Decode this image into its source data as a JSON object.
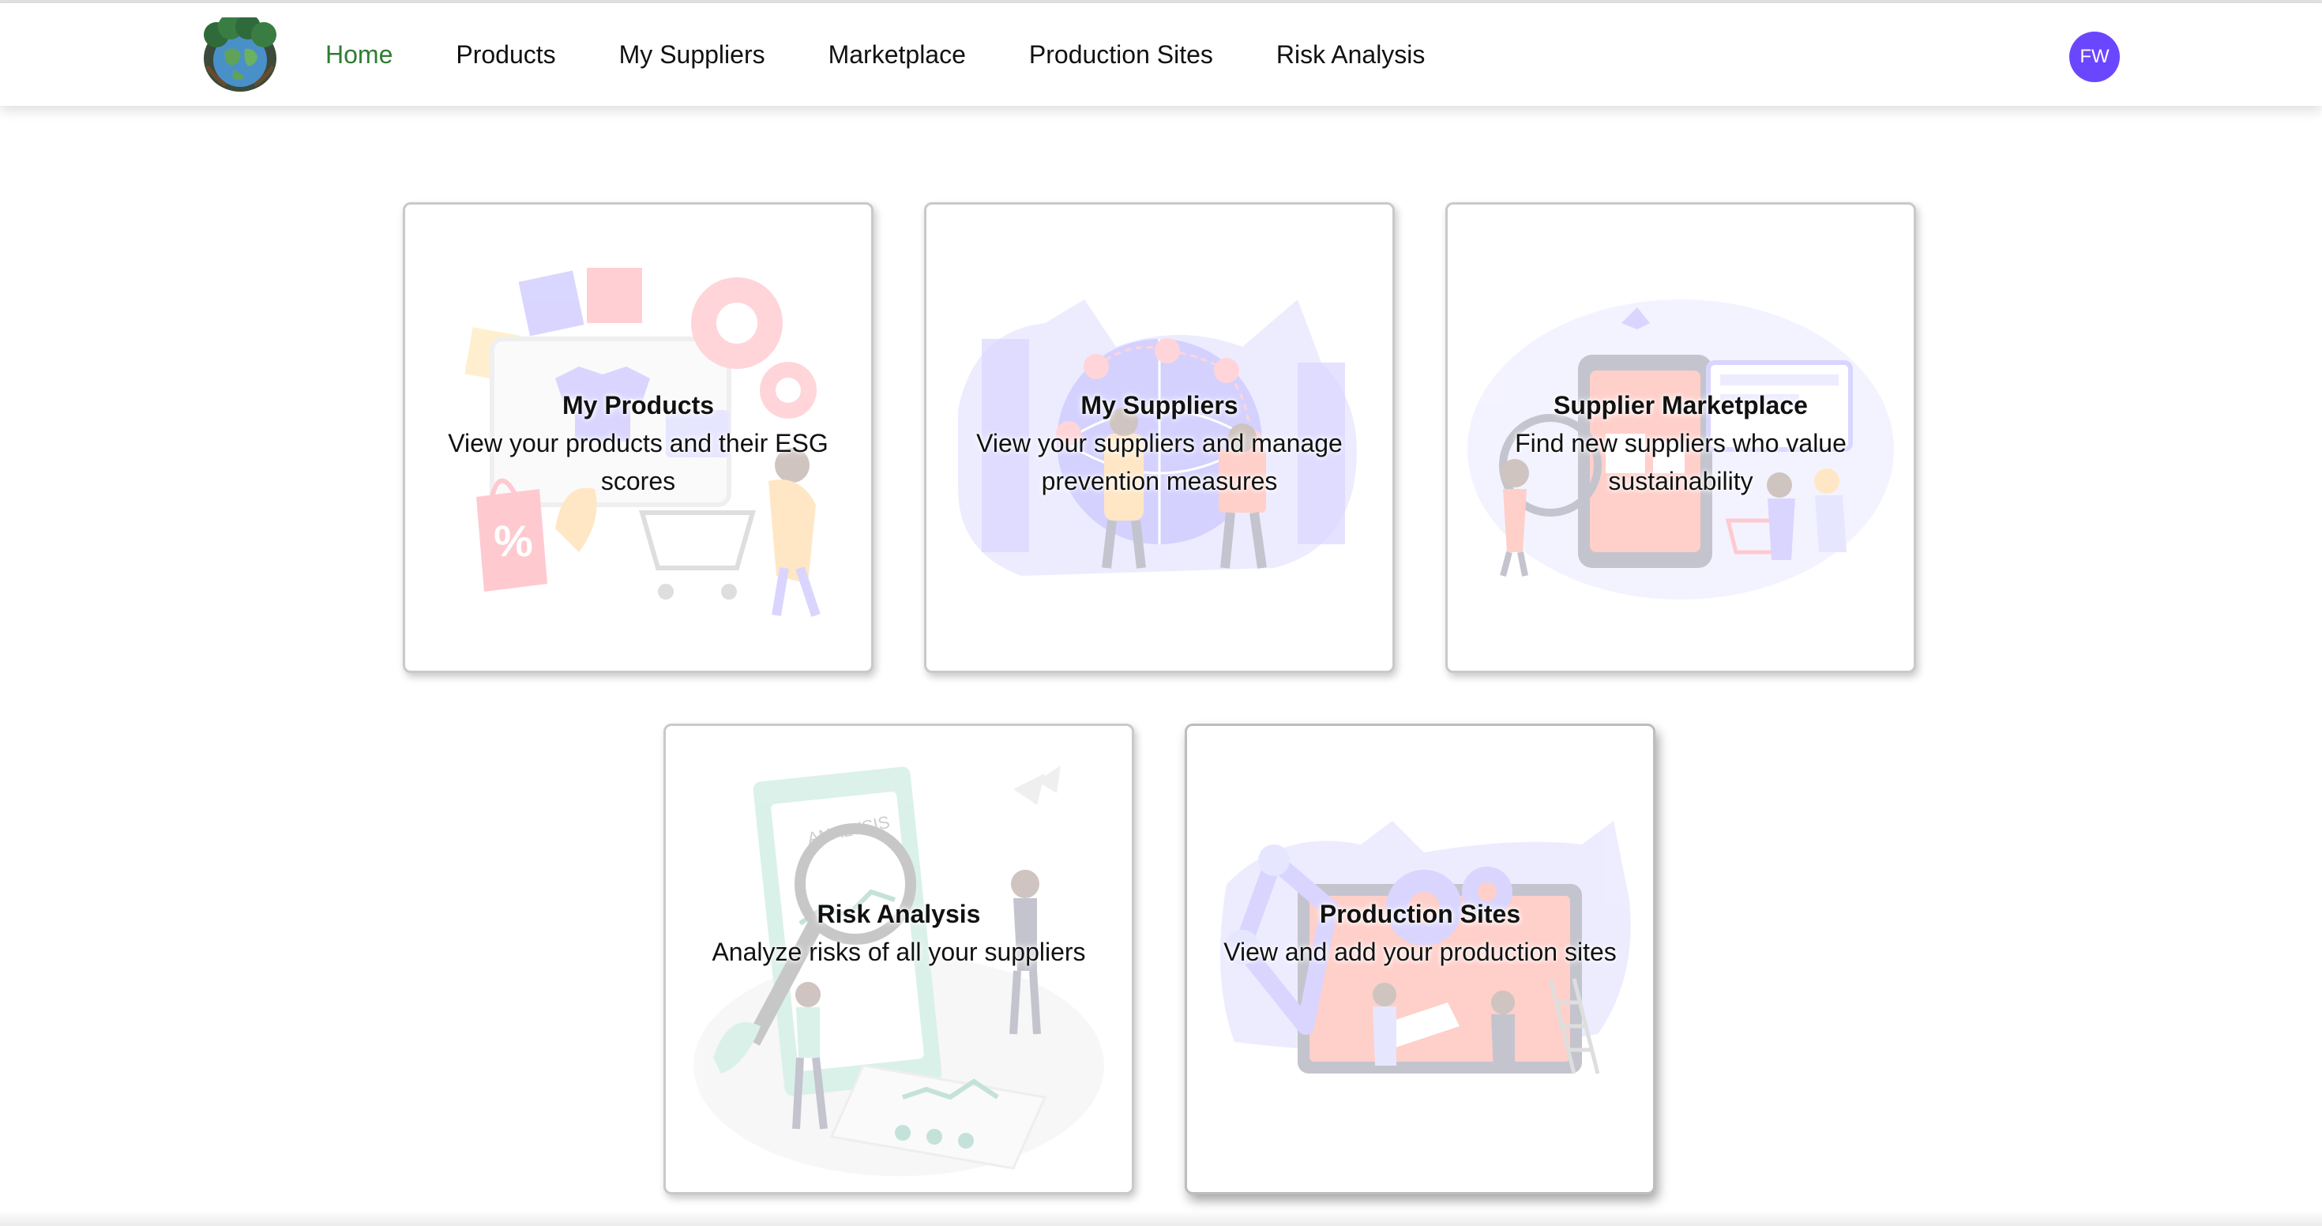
{
  "app": {
    "logo_icon": "globe-tree-logo",
    "accent_color": "#2e7d32",
    "avatar_color": "#6b46ff"
  },
  "nav": {
    "items": [
      {
        "label": "Home",
        "active": true
      },
      {
        "label": "Products",
        "active": false
      },
      {
        "label": "My Suppliers",
        "active": false
      },
      {
        "label": "Marketplace",
        "active": false
      },
      {
        "label": "Production Sites",
        "active": false
      },
      {
        "label": "Risk Analysis",
        "active": false
      }
    ],
    "avatar_initials": "FW"
  },
  "cards": [
    {
      "title": "My Products",
      "description": "View your products and their ESG scores",
      "icon": "shopping-illustration"
    },
    {
      "title": "My Suppliers",
      "description": "View your suppliers and manage prevention measures",
      "icon": "global-network-illustration"
    },
    {
      "title": "Supplier Marketplace",
      "description": "Find new suppliers who value sustainability",
      "icon": "marketplace-illustration"
    },
    {
      "title": "Risk Analysis",
      "description": "Analyze risks of all your suppliers",
      "icon": "analysis-illustration"
    },
    {
      "title": "Production Sites",
      "description": "View and add your production sites",
      "icon": "factory-illustration"
    }
  ]
}
